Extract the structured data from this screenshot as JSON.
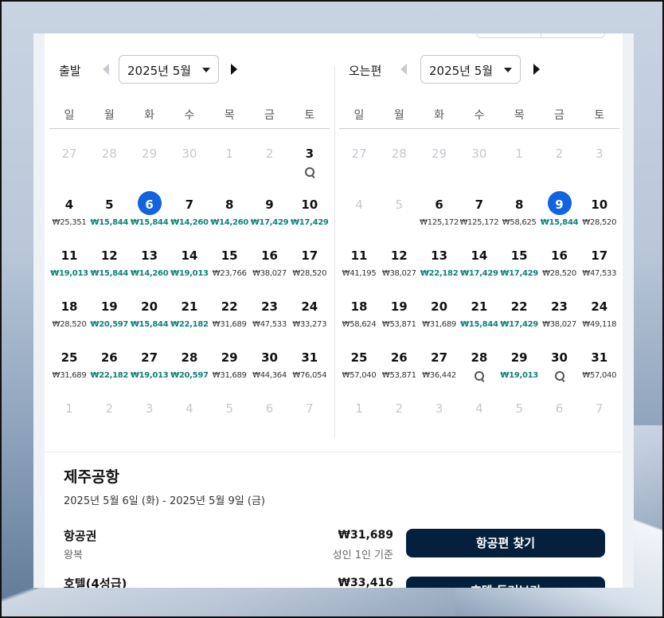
{
  "depart": {
    "label": "출발",
    "month": "2025년 5월",
    "weekdays": [
      "일",
      "월",
      "화",
      "수",
      "목",
      "금",
      "토"
    ],
    "weeks": [
      [
        {
          "d": "27",
          "m": true
        },
        {
          "d": "28",
          "m": true
        },
        {
          "d": "29",
          "m": true
        },
        {
          "d": "30",
          "m": true
        },
        {
          "d": "1",
          "m": true
        },
        {
          "d": "2",
          "m": true
        },
        {
          "d": "3",
          "s": true
        }
      ],
      [
        {
          "d": "4",
          "p": "₩25,351"
        },
        {
          "d": "5",
          "p": "₩15,844",
          "c": true
        },
        {
          "d": "6",
          "p": "₩15,844",
          "c": true,
          "sel": true
        },
        {
          "d": "7",
          "p": "₩14,260",
          "c": true
        },
        {
          "d": "8",
          "p": "₩14,260",
          "c": true
        },
        {
          "d": "9",
          "p": "₩17,429",
          "c": true
        },
        {
          "d": "10",
          "p": "₩17,429",
          "c": true
        }
      ],
      [
        {
          "d": "11",
          "p": "₩19,013",
          "c": true
        },
        {
          "d": "12",
          "p": "₩15,844",
          "c": true
        },
        {
          "d": "13",
          "p": "₩14,260",
          "c": true
        },
        {
          "d": "14",
          "p": "₩19,013",
          "c": true
        },
        {
          "d": "15",
          "p": "₩23,766"
        },
        {
          "d": "16",
          "p": "₩38,027"
        },
        {
          "d": "17",
          "p": "₩28,520"
        }
      ],
      [
        {
          "d": "18",
          "p": "₩28,520"
        },
        {
          "d": "19",
          "p": "₩20,597",
          "c": true
        },
        {
          "d": "20",
          "p": "₩15,844",
          "c": true
        },
        {
          "d": "21",
          "p": "₩22,182",
          "c": true
        },
        {
          "d": "22",
          "p": "₩31,689"
        },
        {
          "d": "23",
          "p": "₩47,533"
        },
        {
          "d": "24",
          "p": "₩33,273"
        }
      ],
      [
        {
          "d": "25",
          "p": "₩31,689"
        },
        {
          "d": "26",
          "p": "₩22,182",
          "c": true
        },
        {
          "d": "27",
          "p": "₩19,013",
          "c": true
        },
        {
          "d": "28",
          "p": "₩20,597",
          "c": true
        },
        {
          "d": "29",
          "p": "₩31,689"
        },
        {
          "d": "30",
          "p": "₩44,364"
        },
        {
          "d": "31",
          "p": "₩76,054"
        }
      ],
      [
        {
          "d": "1",
          "m": true
        },
        {
          "d": "2",
          "m": true
        },
        {
          "d": "3",
          "m": true
        },
        {
          "d": "4",
          "m": true
        },
        {
          "d": "5",
          "m": true
        },
        {
          "d": "6",
          "m": true
        },
        {
          "d": "7",
          "m": true
        }
      ]
    ]
  },
  "return": {
    "label": "오는편",
    "month": "2025년 5월",
    "weekdays": [
      "일",
      "월",
      "화",
      "수",
      "목",
      "금",
      "토"
    ],
    "weeks": [
      [
        {
          "d": "27",
          "m": true
        },
        {
          "d": "28",
          "m": true
        },
        {
          "d": "29",
          "m": true
        },
        {
          "d": "30",
          "m": true
        },
        {
          "d": "1",
          "m": true
        },
        {
          "d": "2",
          "m": true
        },
        {
          "d": "3",
          "m": true
        }
      ],
      [
        {
          "d": "4",
          "m": true
        },
        {
          "d": "5",
          "m": true
        },
        {
          "d": "6",
          "p": "₩125,172"
        },
        {
          "d": "7",
          "p": "₩125,172"
        },
        {
          "d": "8",
          "p": "₩58,625"
        },
        {
          "d": "9",
          "p": "₩15,844",
          "c": true,
          "sel": true
        },
        {
          "d": "10",
          "p": "₩28,520"
        }
      ],
      [
        {
          "d": "11",
          "p": "₩41,195"
        },
        {
          "d": "12",
          "p": "₩38,027"
        },
        {
          "d": "13",
          "p": "₩22,182",
          "c": true
        },
        {
          "d": "14",
          "p": "₩17,429",
          "c": true
        },
        {
          "d": "15",
          "p": "₩17,429",
          "c": true
        },
        {
          "d": "16",
          "p": "₩28,520"
        },
        {
          "d": "17",
          "p": "₩47,533"
        }
      ],
      [
        {
          "d": "18",
          "p": "₩58,624"
        },
        {
          "d": "19",
          "p": "₩53,871"
        },
        {
          "d": "20",
          "p": "₩31,689"
        },
        {
          "d": "21",
          "p": "₩15,844",
          "c": true
        },
        {
          "d": "22",
          "p": "₩17,429",
          "c": true
        },
        {
          "d": "23",
          "p": "₩38,027"
        },
        {
          "d": "24",
          "p": "₩49,118"
        }
      ],
      [
        {
          "d": "25",
          "p": "₩57,040"
        },
        {
          "d": "26",
          "p": "₩53,871"
        },
        {
          "d": "27",
          "p": "₩36,442"
        },
        {
          "d": "28",
          "s": true
        },
        {
          "d": "29",
          "p": "₩19,013",
          "c": true
        },
        {
          "d": "30",
          "s": true
        },
        {
          "d": "31",
          "p": "₩57,040"
        }
      ],
      [
        {
          "d": "1",
          "m": true
        },
        {
          "d": "2",
          "m": true
        },
        {
          "d": "3",
          "m": true
        },
        {
          "d": "4",
          "m": true
        },
        {
          "d": "5",
          "m": true
        },
        {
          "d": "6",
          "m": true
        },
        {
          "d": "7",
          "m": true
        }
      ]
    ]
  },
  "summary": {
    "destination": "제주공항",
    "dates": "2025년 5월 6일 (화) - 2025년 5월 9일 (금)",
    "flight": {
      "label": "항공권",
      "sub": "왕복",
      "price": "₩31,689",
      "note": "성인 1인 기준",
      "button": "항공편 찾기"
    },
    "hotel": {
      "label": "호텔(4성급)",
      "price": "₩33,416",
      "button": "호텔 둘러보기"
    }
  },
  "colors": {
    "selected": "#1163df",
    "cheap": "#0e8277",
    "cta": "#05203c"
  }
}
